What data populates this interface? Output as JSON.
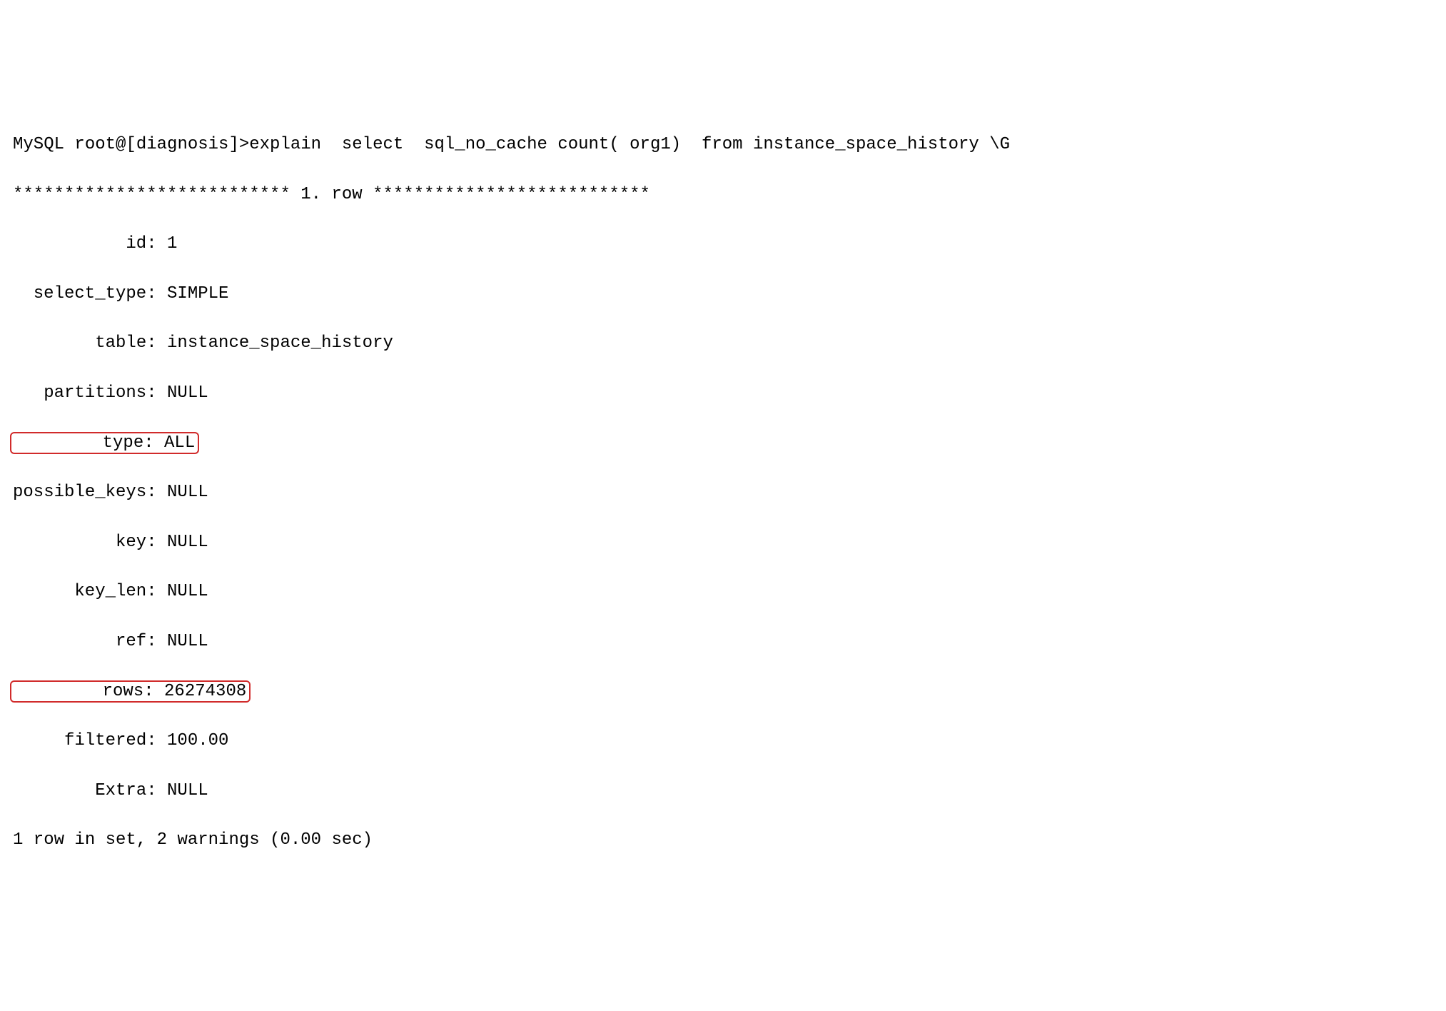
{
  "prompt_line": "MySQL root@[diagnosis]>explain  select  sql_no_cache count( org1)  from instance_space_history \\G",
  "row_header": "*************************** 1. row ***************************",
  "fields": {
    "id": {
      "label": "id",
      "value": "1"
    },
    "select_type": {
      "label": "select_type",
      "value": "SIMPLE"
    },
    "table": {
      "label": "table",
      "value": "instance_space_history"
    },
    "partitions": {
      "label": "partitions",
      "value": "NULL"
    },
    "type": {
      "label": "type",
      "value": "ALL"
    },
    "possible_keys": {
      "label": "possible_keys",
      "value": "NULL"
    },
    "key": {
      "label": "key",
      "value": "NULL"
    },
    "key_len": {
      "label": "key_len",
      "value": "NULL"
    },
    "ref": {
      "label": "ref",
      "value": "NULL"
    },
    "rows": {
      "label": "rows",
      "value": "26274308"
    },
    "filtered": {
      "label": "filtered",
      "value": "100.00"
    },
    "extra": {
      "label": "Extra",
      "value": "NULL"
    }
  },
  "footer": "1 row in set, 2 warnings (0.00 sec)",
  "sep": ": "
}
